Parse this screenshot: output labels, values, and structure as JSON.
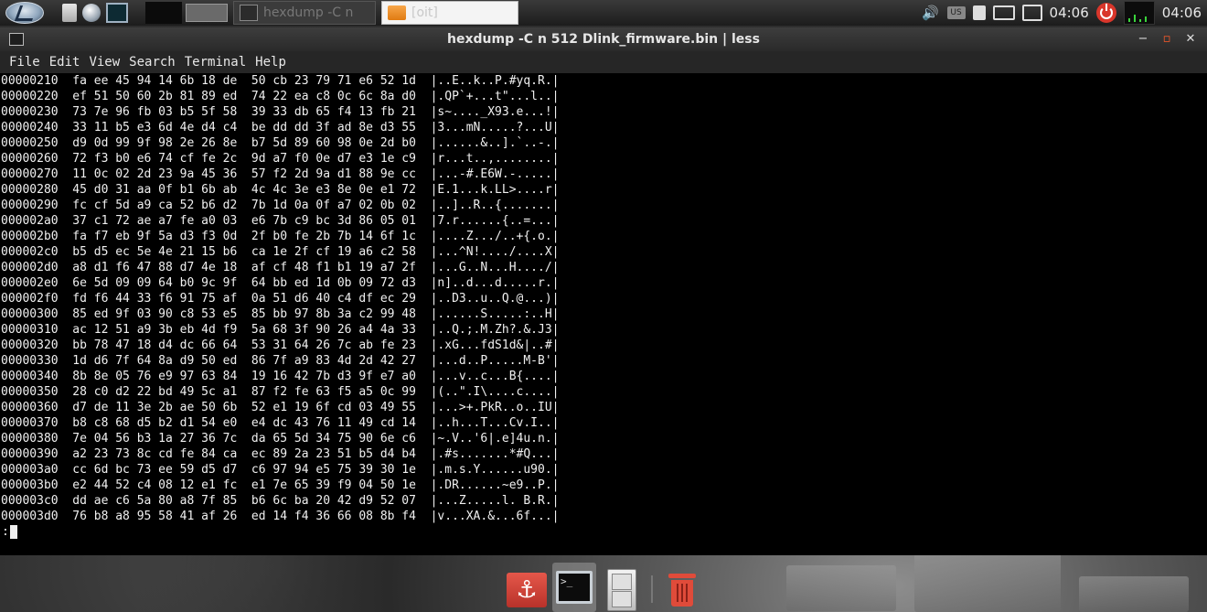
{
  "top_panel": {
    "tasks": [
      {
        "label": "hexdump -C n",
        "icon": "terminal-icon"
      },
      {
        "label": "[oit]",
        "icon": "folder-icon"
      }
    ],
    "tray": {
      "lang_badge": "US",
      "clock_left": "04:06",
      "clock_right": "04:06"
    }
  },
  "window": {
    "title": "hexdump -C n 512 Dlink_firmware.bin | less",
    "menu": [
      "File",
      "Edit",
      "View",
      "Search",
      "Terminal",
      "Help"
    ]
  },
  "terminal": {
    "lines": [
      "00000210  fa ee 45 94 14 6b 18 de  50 cb 23 79 71 e6 52 1d  |..E..k..P.#yq.R.|",
      "00000220  ef 51 50 60 2b 81 89 ed  74 22 ea c8 0c 6c 8a d0  |.QP`+...t\"...l..|",
      "00000230  73 7e 96 fb 03 b5 5f 58  39 33 db 65 f4 13 fb 21  |s~...._X93.e...!|",
      "00000240  33 11 b5 e3 6d 4e d4 c4  be dd dd 3f ad 8e d3 55  |3...mN.....?...U|",
      "00000250  d9 0d 99 9f 98 2e 26 8e  b7 5d 89 60 98 0e 2d b0  |......&..].`..-.|",
      "00000260  72 f3 b0 e6 74 cf fe 2c  9d a7 f0 0e d7 e3 1e c9  |r...t..,........|",
      "00000270  11 0c 02 2d 23 9a 45 36  57 f2 2d 9a d1 88 9e cc  |...-#.E6W.-.....|",
      "00000280  45 d0 31 aa 0f b1 6b ab  4c 4c 3e e3 8e 0e e1 72  |E.1...k.LL>....r|",
      "00000290  fc cf 5d a9 ca 52 b6 d2  7b 1d 0a 0f a7 02 0b 02  |..]..R..{.......|",
      "000002a0  37 c1 72 ae a7 fe a0 03  e6 7b c9 bc 3d 86 05 01  |7.r......{..=...|",
      "000002b0  fa f7 eb 9f 5a d3 f3 0d  2f b0 fe 2b 7b 14 6f 1c  |....Z.../..+{.o.|",
      "000002c0  b5 d5 ec 5e 4e 21 15 b6  ca 1e 2f cf 19 a6 c2 58  |...^N!..../....X|",
      "000002d0  a8 d1 f6 47 88 d7 4e 18  af cf 48 f1 b1 19 a7 2f  |...G..N...H..../|",
      "000002e0  6e 5d 09 09 64 b0 9c 9f  64 bb ed 1d 0b 09 72 d3  |n]..d...d.....r.|",
      "000002f0  fd f6 44 33 f6 91 75 af  0a 51 d6 40 c4 df ec 29  |..D3..u..Q.@...)|",
      "00000300  85 ed 9f 03 90 c8 53 e5  85 bb 97 8b 3a c2 99 48  |......S.....:..H|",
      "00000310  ac 12 51 a9 3b eb 4d f9  5a 68 3f 90 26 a4 4a 33  |..Q.;.M.Zh?.&.J3|",
      "00000320  bb 78 47 18 d4 dc 66 64  53 31 64 26 7c ab fe 23  |.xG...fdS1d&|..#|",
      "00000330  1d d6 7f 64 8a d9 50 ed  86 7f a9 83 4d 2d 42 27  |...d..P.....M-B'|",
      "00000340  8b 8e 05 76 e9 97 63 84  19 16 42 7b d3 9f e7 a0  |...v..c...B{....|",
      "00000350  28 c0 d2 22 bd 49 5c a1  87 f2 fe 63 f5 a5 0c 99  |(..\".I\\....c....|",
      "00000360  d7 de 11 3e 2b ae 50 6b  52 e1 19 6f cd 03 49 55  |...>+.PkR..o..IU|",
      "00000370  b8 c8 68 d5 b2 d1 54 e0  e4 dc 43 76 11 49 cd 14  |..h...T...Cv.I..|",
      "00000380  7e 04 56 b3 1a 27 36 7c  da 65 5d 34 75 90 6e c6  |~.V..'6|.e]4u.n.|",
      "00000390  a2 23 73 8c cd fe 84 ca  ec 89 2a 23 51 b5 d4 b4  |.#s.......*#Q...|",
      "000003a0  cc 6d bc 73 ee 59 d5 d7  c6 97 94 e5 75 39 30 1e  |.m.s.Y......u90.|",
      "000003b0  e2 44 52 c4 08 12 e1 fc  e1 7e 65 39 f9 04 50 1e  |.DR......~e9..P.|",
      "000003c0  dd ae c6 5a 80 a8 7f 85  b6 6c ba 20 42 d9 52 07  |...Z.....l. B.R.|",
      "000003d0  76 b8 a8 95 58 41 af 26  ed 14 f4 36 66 08 8b f4  |v...XA.&...6f...|"
    ],
    "prompt": ":"
  },
  "dock": {
    "items": [
      "anchor-icon",
      "terminal-icon",
      "file-cabinet-icon",
      "trash-icon"
    ]
  },
  "colors": {
    "terminal_bg": "#000000",
    "terminal_fg": "#f0f0f0",
    "power": "#d9362b",
    "maximize": "#ff5a2a"
  }
}
